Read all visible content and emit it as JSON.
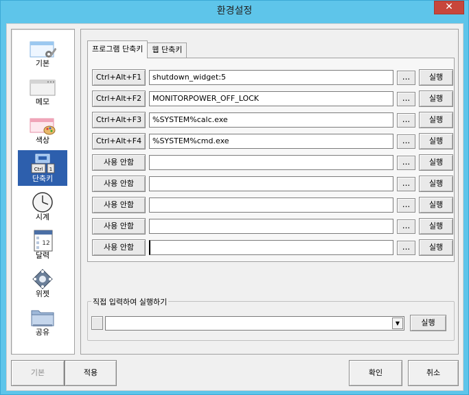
{
  "window": {
    "title": "환경설정",
    "close_glyph": "✕"
  },
  "sidebar": {
    "items": [
      {
        "label": "기본",
        "icon": "window-settings-icon",
        "active": false
      },
      {
        "label": "메모",
        "icon": "window-memo-icon",
        "active": false
      },
      {
        "label": "색상",
        "icon": "palette-icon",
        "active": false
      },
      {
        "label": "단축키",
        "icon": "keyboard-shortcut-icon",
        "active": true
      },
      {
        "label": "시계",
        "icon": "clock-icon",
        "active": false
      },
      {
        "label": "달력",
        "icon": "calendar-icon",
        "active": false
      },
      {
        "label": "위젯",
        "icon": "widget-icon",
        "active": false
      },
      {
        "label": "공유",
        "icon": "shared-folder-icon",
        "active": false
      }
    ]
  },
  "tabs": [
    {
      "label": "프로그램 단축키",
      "active": true
    },
    {
      "label": "웹 단축키",
      "active": false
    }
  ],
  "calendar_icon_day": "12",
  "shortcut_key_icon": {
    "left": "Ctrl",
    "right": "1"
  },
  "shortcuts": [
    {
      "key": "Ctrl+Alt+F1",
      "command": "shutdown_widget:5",
      "browse": "...",
      "run": "실행"
    },
    {
      "key": "Ctrl+Alt+F2",
      "command": "MONITORPOWER_OFF_LOCK",
      "browse": "...",
      "run": "실행"
    },
    {
      "key": "Ctrl+Alt+F3",
      "command": "%SYSTEM%calc.exe",
      "browse": "...",
      "run": "실행"
    },
    {
      "key": "Ctrl+Alt+F4",
      "command": "%SYSTEM%cmd.exe",
      "browse": "...",
      "run": "실행"
    },
    {
      "key": "사용 안함",
      "command": "",
      "browse": "...",
      "run": "실행"
    },
    {
      "key": "사용 안함",
      "command": "",
      "browse": "...",
      "run": "실행"
    },
    {
      "key": "사용 안함",
      "command": "",
      "browse": "...",
      "run": "실행"
    },
    {
      "key": "사용 안함",
      "command": "",
      "browse": "...",
      "run": "실행"
    },
    {
      "key": "사용 안함",
      "command": "",
      "browse": "...",
      "run": "실행"
    }
  ],
  "direct_run": {
    "title": "직접 입력하여 실행하기",
    "value": "",
    "run": "실행"
  },
  "footer": {
    "default": "기본",
    "apply": "적용",
    "ok": "확인",
    "cancel": "취소"
  },
  "colors": {
    "title_bar": "#5ec5ea",
    "close_button": "#c7463b",
    "active_sidebar": "#2d5fad"
  }
}
